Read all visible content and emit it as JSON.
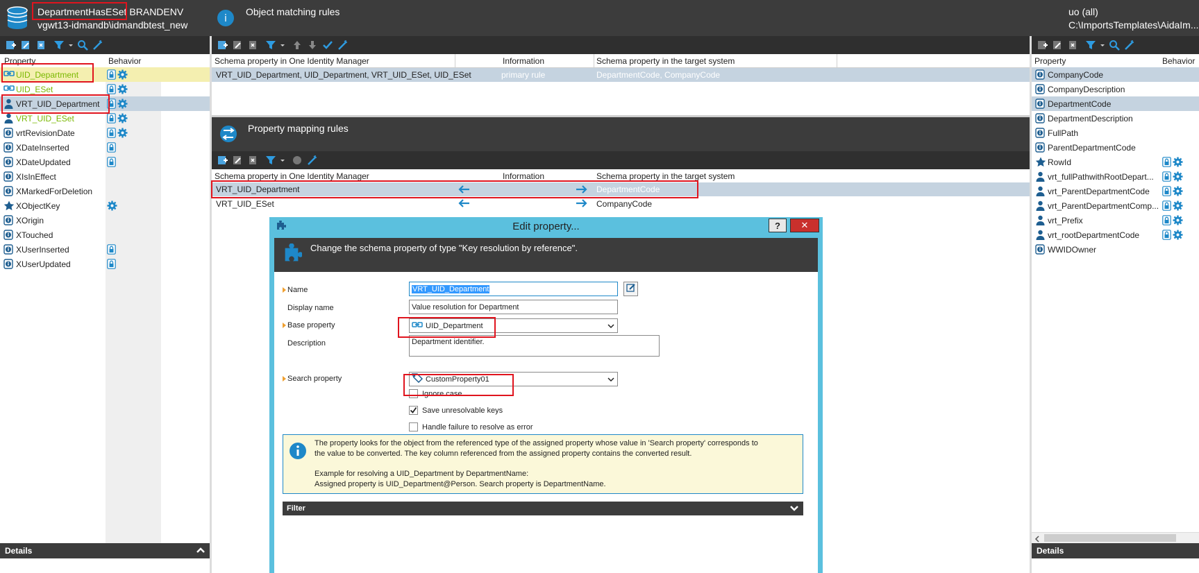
{
  "window": {
    "db_title": "DepartmentHasESet",
    "db_title_suffix": "BRANDENV",
    "db_connection": "vgwt13-idmandb\\idmandbtest_new",
    "right_title": "uo (all)",
    "right_path": "C:\\ImportsTemplates\\AidaIm..."
  },
  "left_panel": {
    "col_property": "Property",
    "col_behavior": "Behavior",
    "items": [
      {
        "label": "UID_Department",
        "style": "green",
        "icon": "key-link-icon",
        "behavior": [
          "lock-icon",
          "gear-icon"
        ],
        "state": "highlight"
      },
      {
        "label": "UID_ESet",
        "style": "green",
        "icon": "key-link-icon",
        "behavior": [
          "lock-icon",
          "gear-icon"
        ],
        "state": ""
      },
      {
        "label": "VRT_UID_Department",
        "style": "",
        "icon": "person-icon",
        "behavior": [
          "lock-icon",
          "gear-icon"
        ],
        "state": "selected"
      },
      {
        "label": "VRT_UID_ESet",
        "style": "green",
        "icon": "person-icon",
        "behavior": [
          "lock-icon",
          "gear-icon"
        ],
        "state": ""
      },
      {
        "label": "vrtRevisionDate",
        "style": "",
        "icon": "info-icon",
        "behavior": [
          "lock-icon",
          "gear-icon"
        ],
        "state": ""
      },
      {
        "label": "XDateInserted",
        "style": "",
        "icon": "info-icon",
        "behavior": [
          "lock-icon"
        ],
        "state": ""
      },
      {
        "label": "XDateUpdated",
        "style": "",
        "icon": "info-icon",
        "behavior": [
          "lock-icon"
        ],
        "state": ""
      },
      {
        "label": "XIsInEffect",
        "style": "",
        "icon": "info-icon",
        "behavior": [],
        "state": ""
      },
      {
        "label": "XMarkedForDeletion",
        "style": "",
        "icon": "info-icon",
        "behavior": [],
        "state": ""
      },
      {
        "label": "XObjectKey",
        "style": "",
        "icon": "star-icon",
        "behavior": [
          "gear-icon"
        ],
        "state": ""
      },
      {
        "label": "XOrigin",
        "style": "",
        "icon": "info-icon",
        "behavior": [],
        "state": ""
      },
      {
        "label": "XTouched",
        "style": "",
        "icon": "info-icon",
        "behavior": [],
        "state": ""
      },
      {
        "label": "XUserInserted",
        "style": "",
        "icon": "info-icon",
        "behavior": [
          "lock-icon"
        ],
        "state": ""
      },
      {
        "label": "XUserUpdated",
        "style": "",
        "icon": "info-icon",
        "behavior": [
          "lock-icon"
        ],
        "state": ""
      }
    ],
    "details_label": "Details"
  },
  "object_matching": {
    "title": "Object matching rules",
    "col_schema_omi": "Schema property in One Identity Manager",
    "col_information": "Information",
    "col_schema_target": "Schema property in the target system",
    "rows": [
      {
        "omi": "VRT_UID_Department, UID_Department, VRT_UID_ESet, UID_ESet",
        "info": "primary rule",
        "target": "DepartmentCode, CompanyCode"
      }
    ]
  },
  "property_mapping": {
    "title": "Property mapping rules",
    "col_schema_omi": "Schema property in One Identity Manager",
    "col_information": "Information",
    "col_schema_target": "Schema property in the target system",
    "rows": [
      {
        "omi": "VRT_UID_Department",
        "target": "DepartmentCode"
      },
      {
        "omi": "VRT_UID_ESet",
        "target": "CompanyCode"
      }
    ]
  },
  "right_panel": {
    "col_property": "Property",
    "col_behavior": "Behavior",
    "items": [
      {
        "label": "CompanyCode",
        "icon": "info-icon",
        "behavior": [],
        "state": "selected"
      },
      {
        "label": "CompanyDescription",
        "icon": "info-icon",
        "behavior": [],
        "state": ""
      },
      {
        "label": "DepartmentCode",
        "icon": "info-icon",
        "behavior": [],
        "state": "selected"
      },
      {
        "label": "DepartmentDescription",
        "icon": "info-icon",
        "behavior": [],
        "state": ""
      },
      {
        "label": "FullPath",
        "icon": "info-icon",
        "behavior": [],
        "state": ""
      },
      {
        "label": "ParentDepartmentCode",
        "icon": "info-icon",
        "behavior": [],
        "state": ""
      },
      {
        "label": "RowId",
        "icon": "star-icon",
        "behavior": [
          "lock-icon",
          "gear-icon"
        ],
        "state": ""
      },
      {
        "label": "vrt_fullPathwithRootDepart...",
        "icon": "person-icon",
        "behavior": [
          "lock-icon",
          "gear-icon"
        ],
        "state": ""
      },
      {
        "label": "vrt_ParentDepartmentCode",
        "icon": "person-icon",
        "behavior": [
          "lock-icon",
          "gear-icon"
        ],
        "state": ""
      },
      {
        "label": "vrt_ParentDepartmentComp...",
        "icon": "person-icon",
        "behavior": [
          "lock-icon",
          "gear-icon"
        ],
        "state": ""
      },
      {
        "label": "vrt_Prefix",
        "icon": "person-icon",
        "behavior": [
          "lock-icon",
          "gear-icon"
        ],
        "state": ""
      },
      {
        "label": "vrt_rootDepartmentCode",
        "icon": "person-icon",
        "behavior": [
          "lock-icon",
          "gear-icon"
        ],
        "state": ""
      },
      {
        "label": "WWIDOwner",
        "icon": "info-icon",
        "behavior": [],
        "state": ""
      }
    ],
    "details_label": "Details"
  },
  "dialog": {
    "title": "Edit property...",
    "help_label": "?",
    "close_label": "✕",
    "header_text": "Change the schema property of type \"Key resolution by reference\".",
    "name_label": "Name",
    "name_value": "VRT_UID_Department",
    "display_name_label": "Display name",
    "display_name_value": "Value resolution for Department",
    "base_property_label": "Base property",
    "base_property_value": "UID_Department",
    "description_label": "Description",
    "description_value": "Department identifier.",
    "search_property_label": "Search property",
    "search_property_value": "CustomProperty01",
    "ignore_case_label": "Ignore case",
    "ignore_case_checked": false,
    "save_unresolvable_label": "Save unresolvable keys",
    "save_unresolvable_checked": true,
    "handle_failure_label": "Handle failure to resolve as error",
    "handle_failure_checked": false,
    "info_line1": "The property looks for the object from the referenced type of the assigned property whose value in 'Search property' corresponds to",
    "info_line2": "the value to be converted. The key column referenced from the assigned property contains the converted result.",
    "info_line3": "Example for resolving a UID_Department by DepartmentName:",
    "info_line4": "Assigned property is UID_Department@Person. Search property is DepartmentName.",
    "filter_label": "Filter"
  },
  "colors": {
    "dark": "#3c3c3c",
    "toolbar": "#2f2f2f",
    "accent_blue": "#1e88c8",
    "dialog_frame": "#5bc0de",
    "highlight_red": "#e0141e",
    "green_text": "#7ab800"
  }
}
